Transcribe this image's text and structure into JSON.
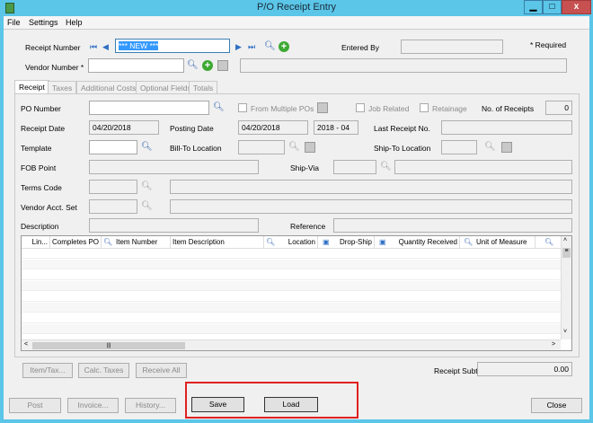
{
  "window": {
    "title": "P/O Receipt Entry",
    "minimize": "▁",
    "maximize": "□",
    "close": "x"
  },
  "menu": [
    "File",
    "Settings",
    "Help"
  ],
  "header": {
    "receipt_number_label": "Receipt Number",
    "receipt_number_value": "*** NEW ***",
    "entered_by_label": "Entered By",
    "entered_by_value": "",
    "required_note": "*  Required",
    "vendor_number_label": "Vendor Number *",
    "vendor_number_value": "",
    "vendor_name_value": ""
  },
  "tabs": [
    "Receipt",
    "Taxes",
    "Additional Costs",
    "Optional Fields",
    "Totals"
  ],
  "form": {
    "po_number_label": "PO Number",
    "from_multiple_pos": "From Multiple POs",
    "job_related": "Job Related",
    "retainage": "Retainage",
    "no_of_receipts_label": "No. of Receipts",
    "no_of_receipts": "0",
    "receipt_date_label": "Receipt Date",
    "receipt_date": "04/20/2018",
    "posting_date_label": "Posting Date",
    "posting_date": "04/20/2018",
    "fiscal_period": "2018 - 04",
    "last_receipt_label": "Last Receipt No.",
    "template_label": "Template",
    "bill_to_label": "Bill-To Location",
    "ship_to_label": "Ship-To Location",
    "fob_label": "FOB Point",
    "ship_via_label": "Ship-Via",
    "terms_label": "Terms Code",
    "vendor_acct_label": "Vendor Acct. Set",
    "description_label": "Description",
    "reference_label": "Reference"
  },
  "grid": {
    "columns": [
      "Lin...",
      "Completes PO",
      "Item Number",
      "Item Description",
      "Location",
      "Drop-Ship",
      "Quantity Received",
      "Unit of Measure"
    ]
  },
  "panel_buttons": {
    "item_tax": "Item/Tax...",
    "calc_taxes": "Calc. Taxes",
    "receive_all": "Receive All",
    "subtotal_label": "Receipt Subtotal",
    "subtotal": "0.00"
  },
  "footer": {
    "post": "Post",
    "invoice": "Invoice...",
    "history": "History...",
    "save": "Save",
    "load": "Load",
    "close": "Close"
  },
  "highlight_color": "#e02020"
}
